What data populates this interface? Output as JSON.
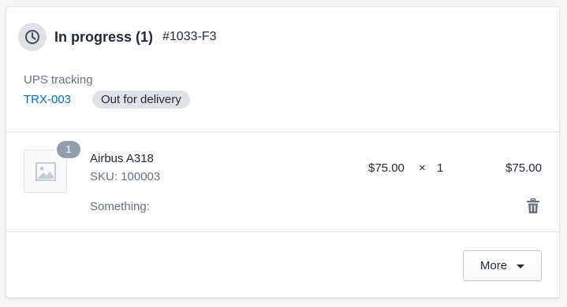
{
  "fulfillment": {
    "status_title": "In progress (1)",
    "order_id": "#1033-F3",
    "status_icon": "clock-icon",
    "tracking": {
      "label": "UPS tracking",
      "number": "TRX-003",
      "delivery_status": "Out for delivery"
    }
  },
  "line_item": {
    "quantity_badge": "1",
    "thumbnail_icon": "image-placeholder-icon",
    "name": "Airbus A318",
    "sku": "SKU: 100003",
    "property_label": "Something:",
    "unit_price": "$75.00",
    "multiply_symbol": "×",
    "quantity": "1",
    "total": "$75.00",
    "remove_icon": "trash-icon"
  },
  "actions": {
    "more_label": "More",
    "more_icon": "caret-down-icon"
  },
  "colors": {
    "link": "#006fbb",
    "badge_bg": "#dfe3e8",
    "qty_badge_bg": "#919eab",
    "subdued_text": "#637381"
  }
}
